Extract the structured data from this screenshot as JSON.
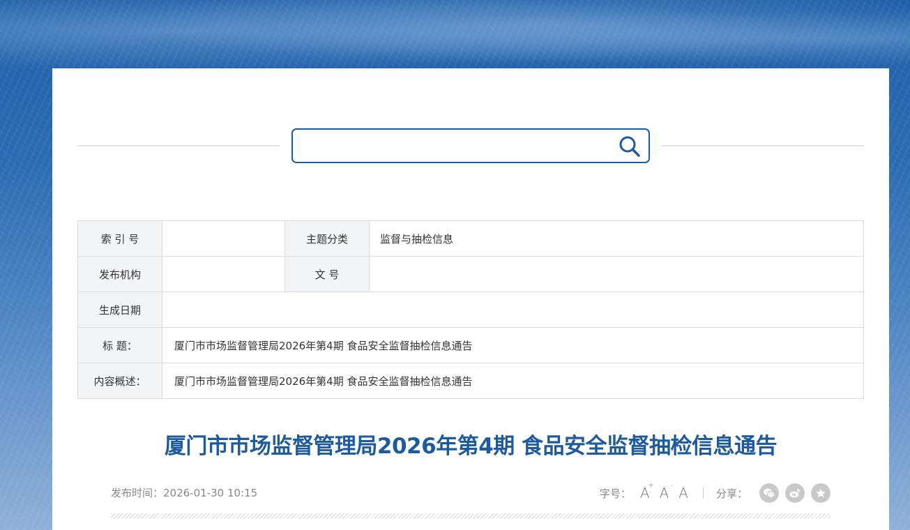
{
  "search": {
    "placeholder": "",
    "value": ""
  },
  "meta": {
    "index_label": "索 引 号",
    "index_value": "",
    "topic_label": "主题分类",
    "topic_value": "监督与抽检信息",
    "publisher_label": "发布机构",
    "publisher_value": "",
    "docno_label": "文 号",
    "docno_value": "",
    "date_label": "生成日期",
    "date_value": "",
    "title_label": "标 题：",
    "title_value": "厦门市市场监督管理局2026年第4期 食品安全监督抽检信息通告",
    "summary_label": "内容概述：",
    "summary_value": "厦门市市场监督管理局2026年第4期 食品安全监督抽检信息通告"
  },
  "article": {
    "title": "厦门市市场监督管理局2026年第4期 食品安全监督抽检信息通告",
    "pubtime": "发布时间：2026-01-30 10:15"
  },
  "tools": {
    "fontsize_label": "字号：",
    "font_large": "A",
    "font_large_sup": "+",
    "font_small": "A",
    "font_small_sup": "-",
    "font_normal": "A",
    "share_label": "分享："
  },
  "icons": {
    "search": "search-icon",
    "wechat": "wechat-icon",
    "weibo": "weibo-icon",
    "favorite": "star-icon"
  },
  "colors": {
    "brand": "#1d5a9e",
    "label_bg": "#f3f4f6",
    "share_icon_bg": "#c9c9c9"
  }
}
